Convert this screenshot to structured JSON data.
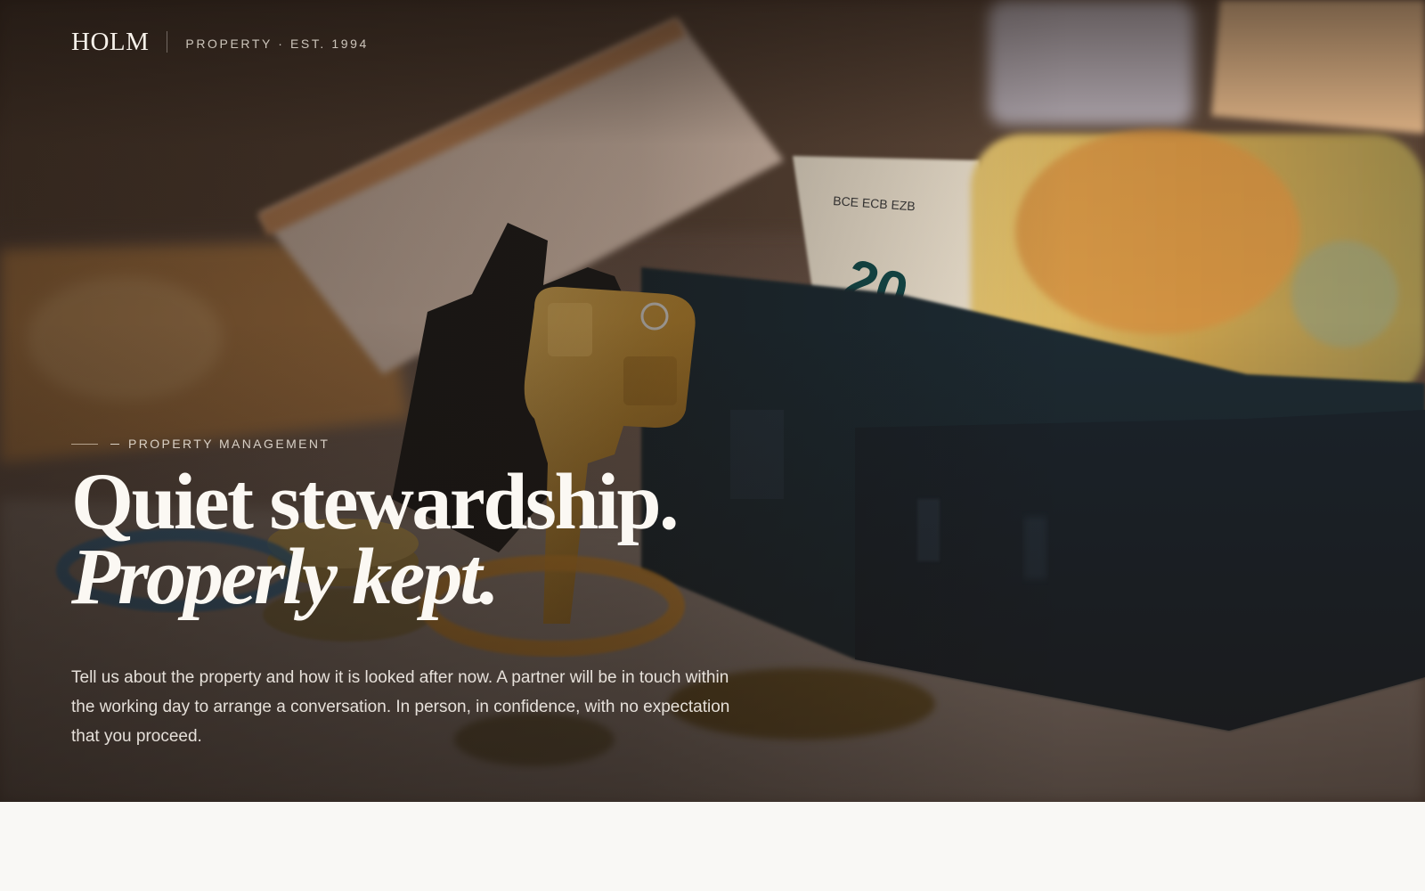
{
  "brand": {
    "logo": "HOLM",
    "tagline": "PROPERTY · EST. 1994"
  },
  "hero": {
    "eyebrow": "PROPERTY MANAGEMENT",
    "headline_line1": "Quiet stewardship.",
    "headline_line2": "Properly kept.",
    "lede": "Tell us about the property and how it is looked after now. A partner will be in touch within the working day to arrange a conversation. In person, in confidence, with no expectation that you proceed.",
    "image": "house-key-euro-notes-photo"
  },
  "colors": {
    "page_background": "#f9f8f5",
    "headline": "#fbf8f3",
    "overlay": "#140e0a"
  }
}
